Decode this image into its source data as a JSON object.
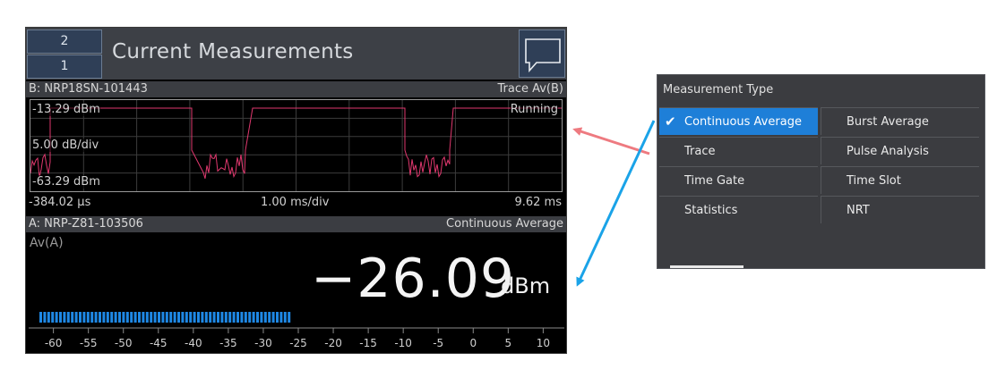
{
  "header": {
    "screen_top": "2",
    "screen_bottom": "1",
    "title": "Current Measurements"
  },
  "trace": {
    "sensor": "B: NRP18SN-101443",
    "mode": "Trace Av(B)",
    "ref_level": "-13.29 dBm",
    "status": "Running",
    "scale": "5.00 dB/div",
    "bottom_level": "-63.29 dBm",
    "x_start": "-384.02 µs",
    "x_div": "1.00 ms/div",
    "x_end": "9.62 ms"
  },
  "numeric": {
    "sensor": "A: NRP-Z81-103506",
    "mode": "Continuous Average",
    "channel": "Av(A)",
    "value": "−26.09",
    "unit": "dBm",
    "bar_value": -26.09,
    "bar_min": -62,
    "bar_max": 12,
    "ticks": [
      "-60",
      "-55",
      "-50",
      "-45",
      "-40",
      "-35",
      "-30",
      "-25",
      "-20",
      "-15",
      "-10",
      "-5",
      "0",
      "5",
      "10"
    ]
  },
  "menu": {
    "title": "Measurement Type",
    "items": [
      {
        "label": "Continuous Average",
        "selected": true
      },
      {
        "label": "Burst Average",
        "selected": false
      },
      {
        "label": "Trace",
        "selected": false
      },
      {
        "label": "Pulse Analysis",
        "selected": false
      },
      {
        "label": "Time Gate",
        "selected": false
      },
      {
        "label": "Time Slot",
        "selected": false
      },
      {
        "label": "Statistics",
        "selected": false
      },
      {
        "label": "NRT",
        "selected": false
      }
    ]
  },
  "colors": {
    "accent": "#1e7fd8",
    "trace_line": "#e0386e",
    "bar_fill": "#1e88e5",
    "arrow_red": "#ee7a80",
    "arrow_blue": "#1aa3e8"
  },
  "icons": {
    "message": "speech-bubble-icon",
    "check": "checkmark-icon"
  }
}
